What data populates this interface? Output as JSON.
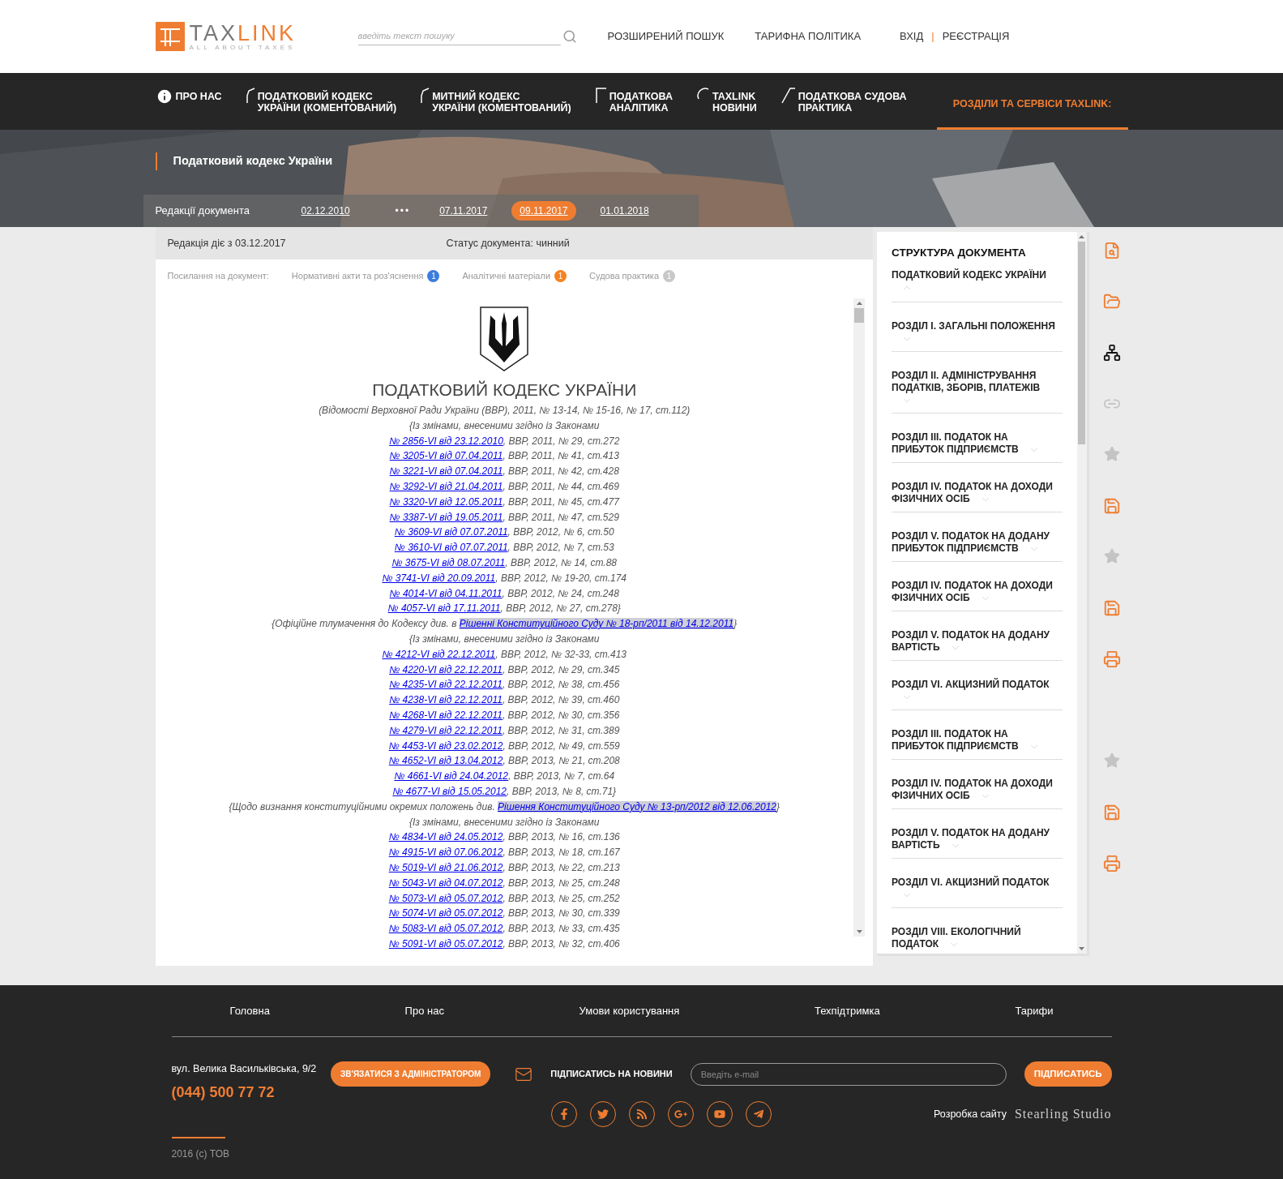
{
  "logo": {
    "word_grey": "TAX",
    "word_orange": "LINK",
    "tagline": "ALL ABOUT TAXES"
  },
  "search": {
    "placeholder": "введіть текст пошуку"
  },
  "header_links": [
    "РОЗШИРЕНИЙ ПОШУК",
    "ТАРИФНА ПОЛІТИКА"
  ],
  "auth": {
    "login": "ВХІД",
    "separator": "|",
    "register": "РЕЄСТРАЦІЯ"
  },
  "nav": [
    {
      "kind": "info",
      "lines": [
        "ПРО НАС"
      ],
      "selected": false
    },
    {
      "kind": "hex",
      "lines": [
        "ПОДАТКОВИЙ КОДЕКС",
        "УКРАЇНИ (КОМЕНТОВАНИЙ)"
      ],
      "selected": false
    },
    {
      "kind": "hex",
      "lines": [
        "МИТНИЙ КОДЕКС",
        "УКРАЇНИ (КОМЕНТОВАНИЙ)"
      ],
      "selected": false
    },
    {
      "kind": "square",
      "lines": [
        "ПОДАТКОВА",
        "АНАЛІТИКА"
      ],
      "selected": false
    },
    {
      "kind": "circle",
      "lines": [
        "TAXLINK",
        "НОВИНИ"
      ],
      "selected": false
    },
    {
      "kind": "triangle",
      "lines": [
        "ПОДАТКОВА СУДОВА",
        "ПРАКТИКА"
      ],
      "selected": false
    },
    {
      "kind": "plain",
      "lines": [
        "РОЗДІЛИ ТА СЕРВІСИ TAXLINK:"
      ],
      "selected": true
    }
  ],
  "hero": {
    "title": "Податковий кодекс України"
  },
  "editions": {
    "label": "Редакції документа",
    "items": [
      {
        "kind": "date",
        "text": "02.12.2010",
        "selected": false
      },
      {
        "kind": "more",
        "text": "•••",
        "selected": false
      },
      {
        "kind": "date",
        "text": "07.11.2017",
        "selected": false
      },
      {
        "kind": "date",
        "text": "09.11.2017",
        "selected": true
      },
      {
        "kind": "date",
        "text": "01.01.2018",
        "selected": false
      }
    ]
  },
  "status": {
    "valid_from": "Редакція діє з 03.12.2017",
    "state": "Статус документа: чинний"
  },
  "references": {
    "label": "Посилання на документ:",
    "items": [
      {
        "text": "Нормативні акти та роз'яснення",
        "count": "1",
        "color": "#3b7ddd"
      },
      {
        "text": "Аналітичні матеріали",
        "count": "1",
        "color": "#f58220"
      },
      {
        "text": "Судова практика",
        "count": "1",
        "color": "#c8c8c8"
      }
    ]
  },
  "document": {
    "title": "ПОДАТКОВИЙ КОДЕКС УКРАЇНИ",
    "lines": [
      {
        "kind": "plain",
        "text": "(Відомості Верховної Ради України (ВВР), 2011, № 13-14, № 15-16, № 17, ст.112)"
      },
      {
        "kind": "plain",
        "text": "{Із змінами, внесеними згідно із Законами"
      },
      {
        "kind": "law",
        "link": "№ 2856-VI від 23.12.2010",
        "rest": ", ВВР, 2011, № 29, ст.272"
      },
      {
        "kind": "law",
        "link": "№ 3205-VI від 07.04.2011",
        "rest": ", ВВР, 2011, № 41, ст.413"
      },
      {
        "kind": "law",
        "link": "№ 3221-VI від 07.04.2011",
        "rest": ", ВВР, 2011, № 42, ст.428"
      },
      {
        "kind": "law",
        "link": "№ 3292-VI від 21.04.2011",
        "rest": ", ВВР, 2011, № 44, ст.469"
      },
      {
        "kind": "law",
        "link": "№ 3320-VI від 12.05.2011",
        "rest": ", ВВР, 2011, № 45, ст.477"
      },
      {
        "kind": "law",
        "link": "№ 3387-VI від 19.05.2011",
        "rest": ", ВВР, 2011, № 47, ст.529"
      },
      {
        "kind": "law",
        "link": "№ 3609-VI від 07.07.2011",
        "rest": ", ВВР, 2012, № 6, ст.50"
      },
      {
        "kind": "law",
        "link": "№ 3610-VI від 07.07.2011",
        "rest": ", ВВР, 2012, № 7, ст.53"
      },
      {
        "kind": "law",
        "link": "№ 3675-VI від 08.07.2011",
        "rest": ", ВВР, 2012, № 14, ст.88"
      },
      {
        "kind": "law",
        "link": "№ 3741-VI від 20.09.2011",
        "rest": ", ВВР, 2012, № 19-20, ст.174"
      },
      {
        "kind": "law",
        "link": "№ 4014-VI від 04.11.2011",
        "rest": ", ВВР, 2012, № 24, ст.248"
      },
      {
        "kind": "law",
        "link": "№ 4057-VI від 17.11.2011",
        "rest": ", ВВР, 2012, № 27, ст.278}"
      },
      {
        "kind": "ruling",
        "text": "{Офіційне тлумачення до Кодексу див. в ",
        "link": "Рішенні Конституційного Суду № 18-рп/2011 від 14.12.2011",
        "rest": "}"
      },
      {
        "kind": "plain",
        "text": "{Із змінами, внесеними згідно із Законами"
      },
      {
        "kind": "law",
        "link": "№ 4212-VI від 22.12.2011",
        "rest": ", ВВР, 2012, № 32-33, ст.413"
      },
      {
        "kind": "law",
        "link": "№ 4220-VI від 22.12.2011",
        "rest": ", ВВР, 2012, № 29, ст.345"
      },
      {
        "kind": "law",
        "link": "№ 4235-VI від 22.12.2011",
        "rest": ", ВВР, 2012, № 38, ст.456"
      },
      {
        "kind": "law",
        "link": "№ 4238-VI від 22.12.2011",
        "rest": ", ВВР, 2012, № 39, ст.460"
      },
      {
        "kind": "law",
        "link": "№ 4268-VI від 22.12.2011",
        "rest": ", ВВР, 2012, № 30, ст.356"
      },
      {
        "kind": "law",
        "link": "№ 4279-VI від 22.12.2011",
        "rest": ", ВВР, 2012, № 31, ст.389"
      },
      {
        "kind": "law",
        "link": "№ 4453-VI від 23.02.2012",
        "rest": ", ВВР, 2012, № 49, ст.559"
      },
      {
        "kind": "law",
        "link": "№ 4652-VI від 13.04.2012",
        "rest": ", ВВР, 2013, № 21, ст.208"
      },
      {
        "kind": "law",
        "link": "№ 4661-VI від 24.04.2012",
        "rest": ", ВВР, 2013, № 7, ст.64"
      },
      {
        "kind": "law",
        "link": "№ 4677-VI від 15.05.2012",
        "rest": ", ВВР, 2013, № 8, ст.71}"
      },
      {
        "kind": "ruling",
        "text": "{Щодо визнання конституційними окремих положень див. ",
        "link": "Рішення Конституційного Суду № 13-рп/2012 від 12.06.2012",
        "rest": "}"
      },
      {
        "kind": "plain",
        "text": "{Із змінами, внесеними згідно із Законами"
      },
      {
        "kind": "law",
        "link": "№ 4834-VI від 24.05.2012",
        "rest": ", ВВР, 2013, № 16, ст.136"
      },
      {
        "kind": "law",
        "link": "№ 4915-VI від 07.06.2012",
        "rest": ", ВВР, 2013, № 18, ст.167"
      },
      {
        "kind": "law",
        "link": "№ 5019-VI від 21.06.2012",
        "rest": ", ВВР, 2013, № 22, ст.213"
      },
      {
        "kind": "law",
        "link": "№ 5043-VI від 04.07.2012",
        "rest": ", ВВР, 2013, № 25, ст.248"
      },
      {
        "kind": "law",
        "link": "№ 5073-VI від 05.07.2012",
        "rest": ", ВВР, 2013, № 25, ст.252"
      },
      {
        "kind": "law",
        "link": "№ 5074-VI від 05.07.2012",
        "rest": ", ВВР, 2013, № 30, ст.339"
      },
      {
        "kind": "law",
        "link": "№ 5083-VI від 05.07.2012",
        "rest": ", ВВР, 2013, № 33, ст.435"
      },
      {
        "kind": "law",
        "link": "№ 5091-VI від 05.07.2012",
        "rest": ", ВВР, 2013, № 32, ст.406"
      }
    ]
  },
  "structure": {
    "title": "СТРУКТУРА ДОКУМЕНТА",
    "items": [
      {
        "text": "ПОДАТКОВИЙ КОДЕКС УКРАЇНИ",
        "expanded": true
      },
      {
        "text": "РОЗДІЛ I. ЗАГАЛЬНІ ПОЛОЖЕННЯ",
        "expanded": false
      },
      {
        "text": "РОЗДІЛ II. АДМІНІСТРУВАННЯ ПОДАТКІВ, ЗБОРІВ, ПЛАТЕЖІВ",
        "expanded": false
      },
      {
        "text": "РОЗДІЛ III. ПОДАТОК НА ПРИБУТОК ПІДПРИЄМСТВ",
        "expanded": false
      },
      {
        "text": "РОЗДІЛ IV. ПОДАТОК НА ДОХОДИ ФІЗИЧНИХ ОСІБ",
        "expanded": false
      },
      {
        "text": "РОЗДІЛ V. ПОДАТОК НА ДОДАНУ ПРИБУТОК ПІДПРИЄМСТВ",
        "expanded": false
      },
      {
        "text": "РОЗДІЛ IV. ПОДАТОК НА ДОХОДИ ФІЗИЧНИХ ОСІБ",
        "expanded": false
      },
      {
        "text": "РОЗДІЛ V. ПОДАТОК НА ДОДАНУ ВАРТІСТЬ",
        "expanded": false
      },
      {
        "text": "РОЗДІЛ VI. АКЦИЗНИЙ ПОДАТОК",
        "expanded": false
      },
      {
        "text": "РОЗДІЛ III. ПОДАТОК НА ПРИБУТОК ПІДПРИЄМСТВ",
        "expanded": false
      },
      {
        "text": "РОЗДІЛ IV. ПОДАТОК НА ДОХОДИ ФІЗИЧНИХ ОСІБ",
        "expanded": false
      },
      {
        "text": "РОЗДІЛ V. ПОДАТОК НА ДОДАНУ ВАРТІСТЬ",
        "expanded": false
      },
      {
        "text": "РОЗДІЛ VI. АКЦИЗНИЙ ПОДАТОК",
        "expanded": false
      },
      {
        "text": "РОЗДІЛ VIII. ЕКОЛОГІЧНИЙ ПОДАТОК",
        "expanded": false
      }
    ]
  },
  "tool_groups": [
    [
      {
        "kind": "search-doc",
        "disabled": false
      },
      {
        "kind": "folder-info",
        "disabled": false
      },
      {
        "kind": "tree",
        "disabled": false
      },
      {
        "kind": "link",
        "disabled": true
      },
      {
        "kind": "star",
        "disabled": true
      },
      {
        "kind": "save",
        "disabled": false
      },
      {
        "kind": "star",
        "disabled": true
      },
      {
        "kind": "save",
        "disabled": false
      },
      {
        "kind": "print",
        "disabled": false
      }
    ],
    [
      {
        "kind": "star",
        "disabled": true
      },
      {
        "kind": "save",
        "disabled": false
      },
      {
        "kind": "print",
        "disabled": false
      }
    ]
  ],
  "footer": {
    "links": [
      "Головна",
      "Про нас",
      "Умови користування",
      "Техпідтримка",
      "Тарифи"
    ],
    "address": "вул. Велика Васильківська, 9/2",
    "phone": "(044) 500 77 72",
    "contact_button": "ЗВ'ЯЗАТИСЯ З АДМІНІСТРАТОРОМ",
    "subscribe_label": "ПІДПИСАТИСЬ НА НОВИНИ",
    "email": {
      "placeholder": "Введіть e-mail"
    },
    "subscribe_button": "ПІДПИСАТИСЬ",
    "socials": [
      {
        "kind": "facebook"
      },
      {
        "kind": "twitter"
      },
      {
        "kind": "rss"
      },
      {
        "kind": "googleplus"
      },
      {
        "kind": "youtube"
      },
      {
        "kind": "telegram"
      }
    ],
    "developer_label": "Розробка сайту",
    "developer": "Stearling Studio",
    "copyright": "2016 (с) ТОВ"
  }
}
